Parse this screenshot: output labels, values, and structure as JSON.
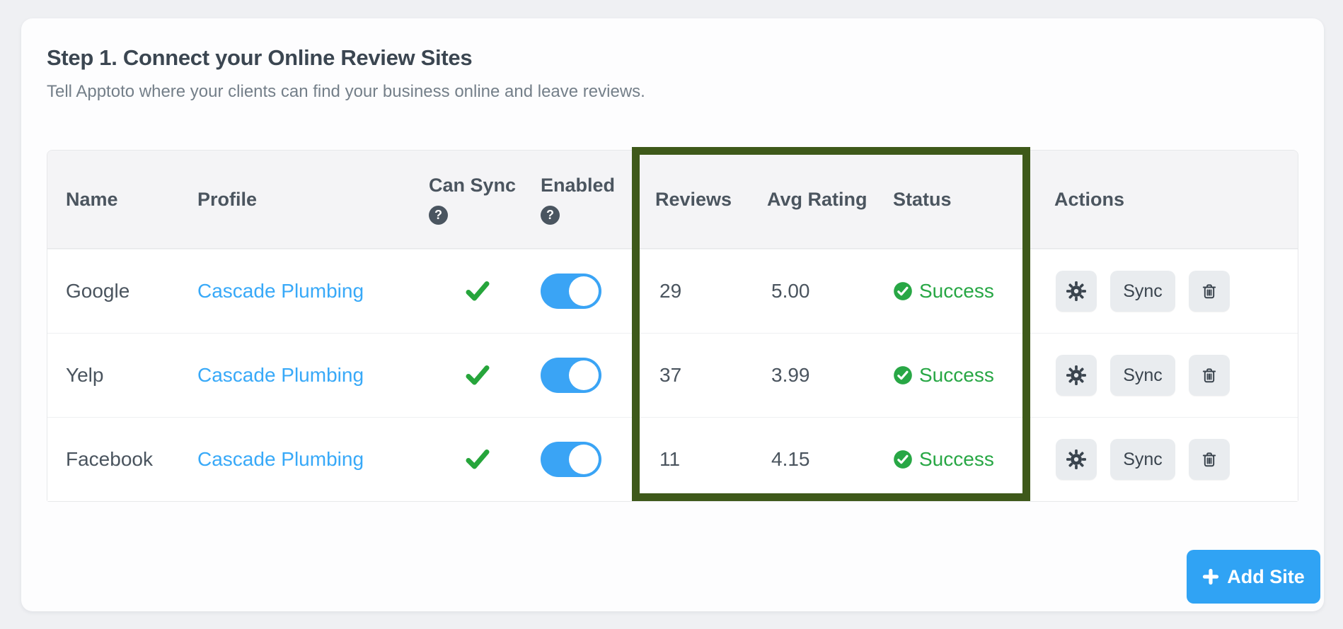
{
  "page": {
    "title": "Step 1. Connect your Online Review Sites",
    "subtitle": "Tell Apptoto where your clients can find your business online and leave reviews."
  },
  "table": {
    "headers": {
      "name": "Name",
      "profile": "Profile",
      "can_sync": "Can Sync",
      "enabled": "Enabled",
      "reviews": "Reviews",
      "avg_rating": "Avg Rating",
      "status": "Status",
      "actions": "Actions"
    },
    "help_icon_glyph": "?",
    "rows": [
      {
        "name": "Google",
        "profile": "Cascade Plumbing",
        "can_sync": true,
        "enabled": true,
        "reviews": "29",
        "avg_rating": "5.00",
        "status": "Success"
      },
      {
        "name": "Yelp",
        "profile": "Cascade Plumbing",
        "can_sync": true,
        "enabled": true,
        "reviews": "37",
        "avg_rating": "3.99",
        "status": "Success"
      },
      {
        "name": "Facebook",
        "profile": "Cascade Plumbing",
        "can_sync": true,
        "enabled": true,
        "reviews": "11",
        "avg_rating": "4.15",
        "status": "Success"
      }
    ],
    "action_labels": {
      "sync": "Sync"
    }
  },
  "add_site_button": {
    "label": "Add Site"
  },
  "colors": {
    "link_blue": "#38a9f8",
    "toggle_blue": "#3aa4f5",
    "button_blue": "#30a3f4",
    "check_green": "#26a53b",
    "success_green": "#28a745",
    "highlight_green": "#3e591a",
    "header_bg": "#f4f4f6",
    "card_bg": "#fdfdfe",
    "page_bg": "#eff0f3"
  }
}
